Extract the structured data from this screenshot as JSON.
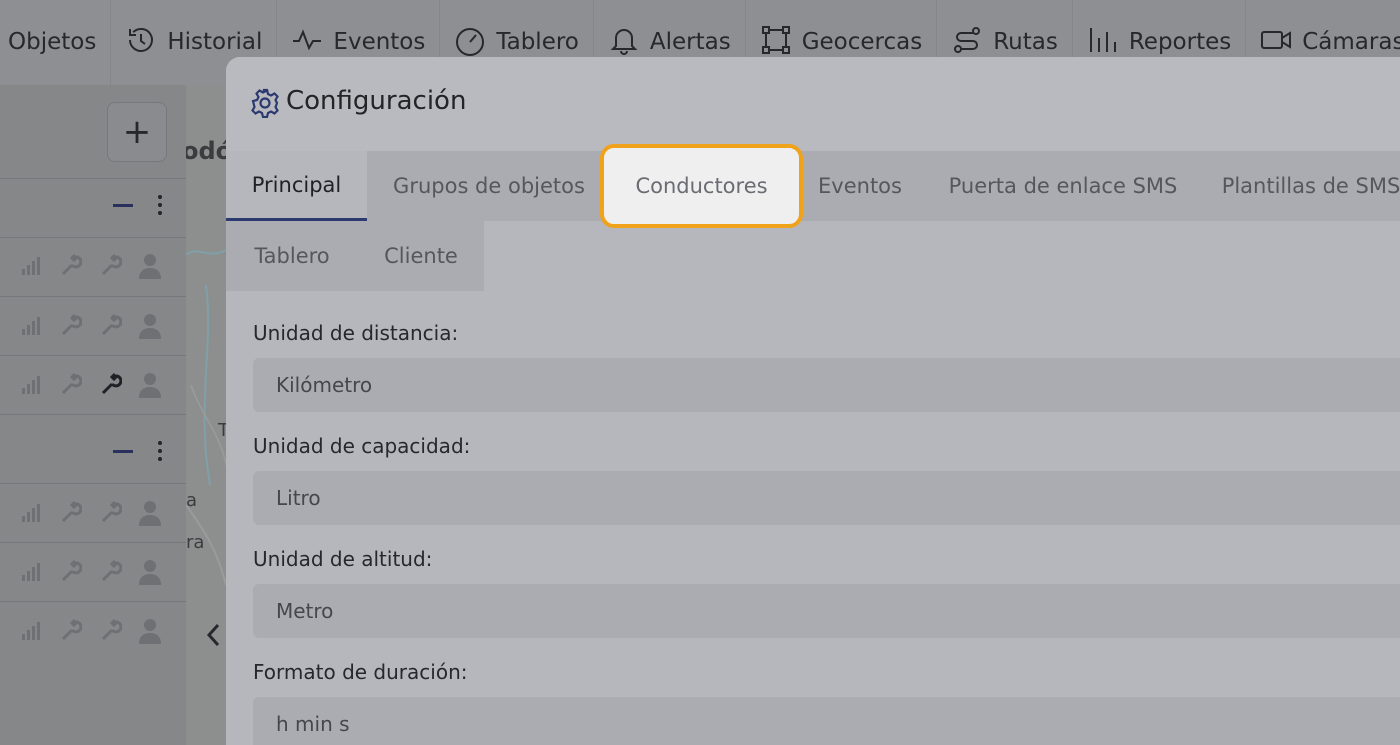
{
  "nav": {
    "items": [
      {
        "label": "Objetos",
        "icon": "none"
      },
      {
        "label": "Historial",
        "icon": "history-icon"
      },
      {
        "label": "Eventos",
        "icon": "pulse-icon"
      },
      {
        "label": "Tablero",
        "icon": "gauge-icon"
      },
      {
        "label": "Alertas",
        "icon": "bell-icon"
      },
      {
        "label": "Geocercas",
        "icon": "geofence-icon"
      },
      {
        "label": "Rutas",
        "icon": "route-icon"
      },
      {
        "label": "Reportes",
        "icon": "chart-bars-icon"
      },
      {
        "label": "Cámaras",
        "icon": "video-camera-icon"
      }
    ]
  },
  "left_panel": {
    "add_label": "+"
  },
  "map": {
    "fragments": [
      "odó",
      "T",
      "a",
      "ra"
    ]
  },
  "modal": {
    "title": "Configuración",
    "tabs": [
      {
        "label": "Principal",
        "state": "active"
      },
      {
        "label": "Grupos de objetos",
        "state": "normal"
      },
      {
        "label": "Conductores",
        "state": "highlighted"
      },
      {
        "label": "Eventos",
        "state": "normal"
      },
      {
        "label": "Puerta de enlace SMS",
        "state": "normal"
      },
      {
        "label": "Plantillas de SMS",
        "state": "normal"
      },
      {
        "label": "Tablero",
        "state": "normal"
      },
      {
        "label": "Cliente",
        "state": "normal"
      }
    ],
    "fields": [
      {
        "label": "Unidad de distancia:",
        "value": "Kilómetro"
      },
      {
        "label": "Unidad de capacidad:",
        "value": "Litro"
      },
      {
        "label": "Unidad de altitud:",
        "value": "Metro"
      },
      {
        "label": "Formato de duración:",
        "value": "h min s"
      }
    ]
  },
  "colors": {
    "highlight_border": "#f0a21a",
    "active_tab_underline": "#2d3a6f",
    "accent_icon": "#2d3a6f"
  }
}
